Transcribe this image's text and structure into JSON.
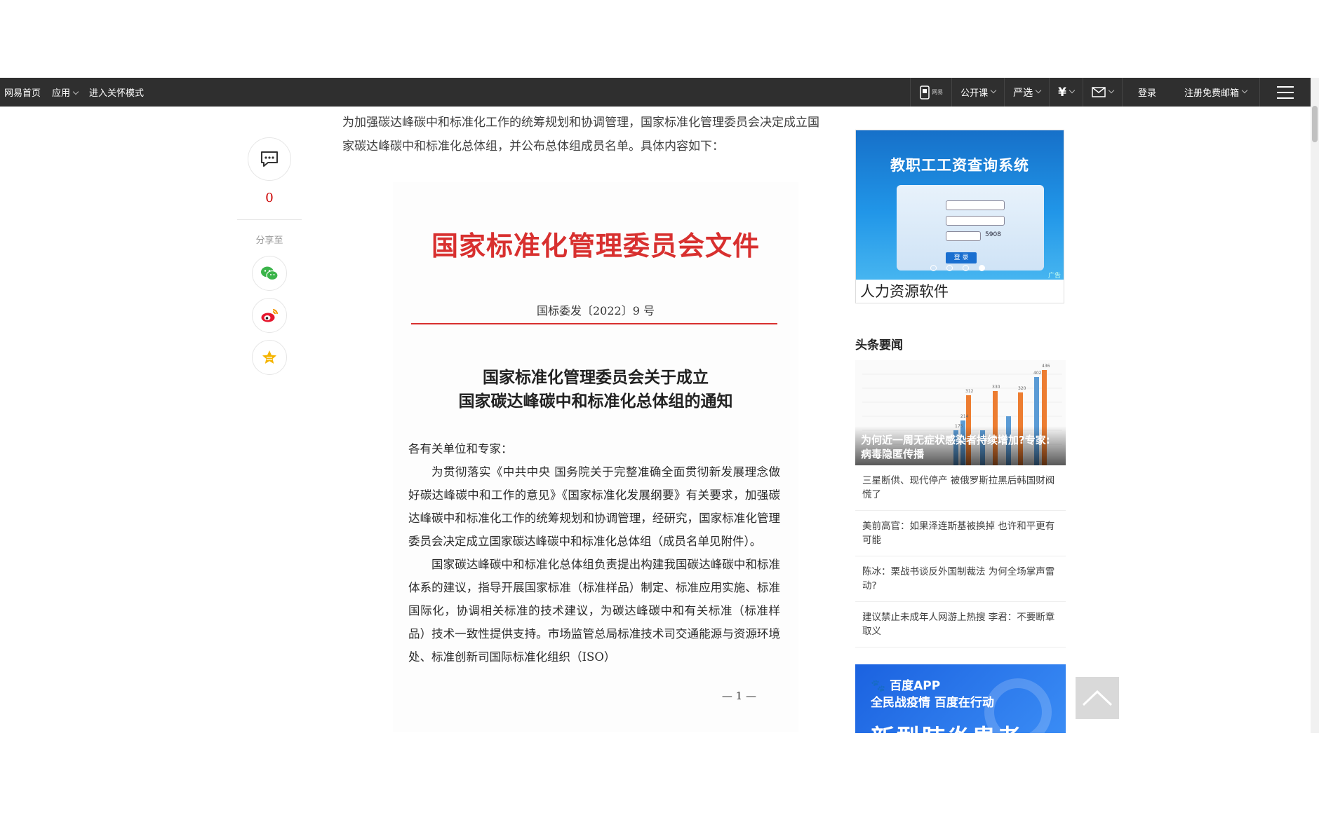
{
  "topbar": {
    "left": {
      "home": "网易首页",
      "apps": "应用",
      "care_mode": "进入关怀模式"
    },
    "right": {
      "phone_label": "网易",
      "open_course": "公开课",
      "yanxuan": "严选",
      "mail_icon": "mail-icon",
      "login": "登录",
      "register": "注册免费邮箱",
      "menu_icon": "hamburger-icon"
    }
  },
  "share": {
    "comment_count": "0",
    "share_label": "分享至",
    "icons": [
      "comment-icon",
      "wechat-icon",
      "weibo-icon",
      "favorite-star-icon"
    ]
  },
  "article": {
    "intro": "为加强碳达峰碳中和标准化工作的统筹规划和协调管理，国家标准化管理委员会决定成立国家碳达峰碳中和标准化总体组，并公布总体组成员名单。具体内容如下：",
    "doc": {
      "header": "国家标准化管理委员会文件",
      "number": "国标委发〔2022〕9 号",
      "title_line1": "国家标准化管理委员会关于成立",
      "title_line2": "国家碳达峰碳中和标准化总体组的通知",
      "salutation": "各有关单位和专家：",
      "para1": "为贯彻落实《中共中央 国务院关于完整准确全面贯彻新发展理念做好碳达峰碳中和工作的意见》《国家标准化发展纲要》有关要求，加强碳达峰碳中和标准化工作的统筹规划和协调管理，经研究，国家标准化管理委员会决定成立国家碳达峰碳中和标准化总体组（成员名单见附件）。",
      "para2": "国家碳达峰碳中和标准化总体组负责提出构建我国碳达峰碳中和标准体系的建议，指导开展国家标准（标准样品）制定、标准应用实施、标准国际化，协调相关标准的技术建议，为碳达峰碳中和有关标准（标准样品）技术一致性提供支持。市场监管总局标准技术司交通能源与资源环境处、标准创新司国际标准化组织（ISO）",
      "page": "— 1 —"
    }
  },
  "sidebar": {
    "ad": {
      "banner_title": "教职工工资查询系统",
      "login_btn": "登 录",
      "captcha": "5908",
      "ad_tag": "广告",
      "caption": "人力资源软件"
    },
    "section_title": "头条要闻",
    "lead": {
      "caption": "为何近一周无症状感染者持续增加?专家:病毒隐匿传播",
      "chart_labels": [
        "175",
        "214",
        "312",
        "330",
        "320",
        "402",
        "436"
      ]
    },
    "news": [
      "三星断供、现代停产 被俄罗斯拉黑后韩国财阀慌了",
      "美前高官：如果泽连斯基被换掉 也许和平更有可能",
      "陈冰：栗战书谈反外国制裁法 为何全场掌声雷动?",
      "建议禁止未成年人网游上热搜 李君：不要断章取义"
    ],
    "baidu_ad": {
      "brand": "百度APP",
      "slogan": "全民战疫情 百度在行动",
      "headline": "新型肺炎患者"
    }
  },
  "colors": {
    "topbar": "#2f2f2f",
    "doc_red": "#d8302f",
    "accent_red": "#cc0000"
  }
}
